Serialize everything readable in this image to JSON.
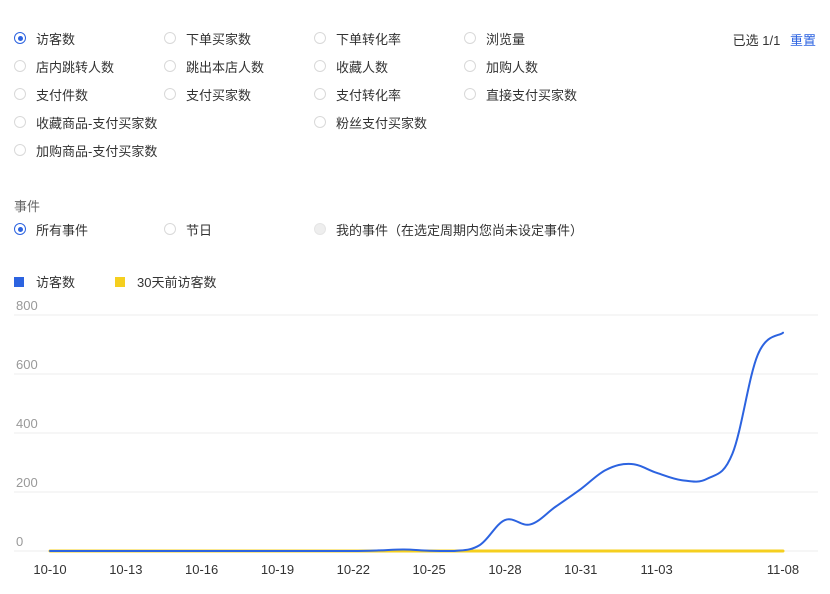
{
  "metrics": {
    "options": [
      {
        "label": "访客数",
        "checked": true
      },
      {
        "label": "下单买家数",
        "checked": false
      },
      {
        "label": "下单转化率",
        "checked": false
      },
      {
        "label": "浏览量",
        "checked": false
      },
      {
        "label": "店内跳转人数",
        "checked": false
      },
      {
        "label": "跳出本店人数",
        "checked": false
      },
      {
        "label": "收藏人数",
        "checked": false
      },
      {
        "label": "加购人数",
        "checked": false
      },
      {
        "label": "支付件数",
        "checked": false
      },
      {
        "label": "支付买家数",
        "checked": false
      },
      {
        "label": "支付转化率",
        "checked": false
      },
      {
        "label": "直接支付买家数",
        "checked": false
      },
      {
        "label": "收藏商品-支付买家数",
        "checked": false
      },
      {
        "label": "粉丝支付买家数",
        "checked": false
      },
      {
        "label": "加购商品-支付买家数",
        "checked": false
      }
    ],
    "selected_text": "已选 1/1",
    "reset_label": "重置"
  },
  "events": {
    "title": "事件",
    "options": [
      {
        "label": "所有事件",
        "checked": true,
        "disabled": false
      },
      {
        "label": "节日",
        "checked": false,
        "disabled": false
      },
      {
        "label": "我的事件（在选定周期内您尚未设定事件）",
        "checked": false,
        "disabled": true
      }
    ]
  },
  "chart_data": {
    "type": "line",
    "x": [
      "10-10",
      "10-11",
      "10-12",
      "10-13",
      "10-14",
      "10-15",
      "10-16",
      "10-17",
      "10-18",
      "10-19",
      "10-20",
      "10-21",
      "10-22",
      "10-23",
      "10-24",
      "10-25",
      "10-26",
      "10-27",
      "10-28",
      "10-29",
      "10-30",
      "10-31",
      "11-01",
      "11-02",
      "11-03",
      "11-04",
      "11-05",
      "11-06",
      "11-07",
      "11-08"
    ],
    "tick_labels": [
      "10-10",
      "10-13",
      "10-16",
      "10-19",
      "10-22",
      "10-25",
      "10-28",
      "10-31",
      "11-03",
      "11-08"
    ],
    "series": [
      {
        "name": "访客数",
        "color": "#2c63e0",
        "values": [
          0,
          0,
          0,
          0,
          0,
          0,
          0,
          0,
          0,
          0,
          0,
          0,
          0,
          2,
          5,
          1,
          0,
          20,
          105,
          90,
          150,
          210,
          275,
          295,
          265,
          240,
          245,
          330,
          665,
          740
        ]
      },
      {
        "name": "30天前访客数",
        "color": "#f5cf1f",
        "values": [
          0,
          0,
          0,
          0,
          0,
          0,
          0,
          0,
          0,
          0,
          0,
          0,
          0,
          0,
          0,
          0,
          0,
          0,
          0,
          0,
          0,
          0,
          0,
          0,
          0,
          0,
          0,
          0,
          0,
          0
        ]
      }
    ],
    "yticks": [
      0,
      200,
      400,
      600,
      800
    ],
    "ylim": [
      0,
      800
    ],
    "grid": true,
    "legend_position": "top-left"
  }
}
